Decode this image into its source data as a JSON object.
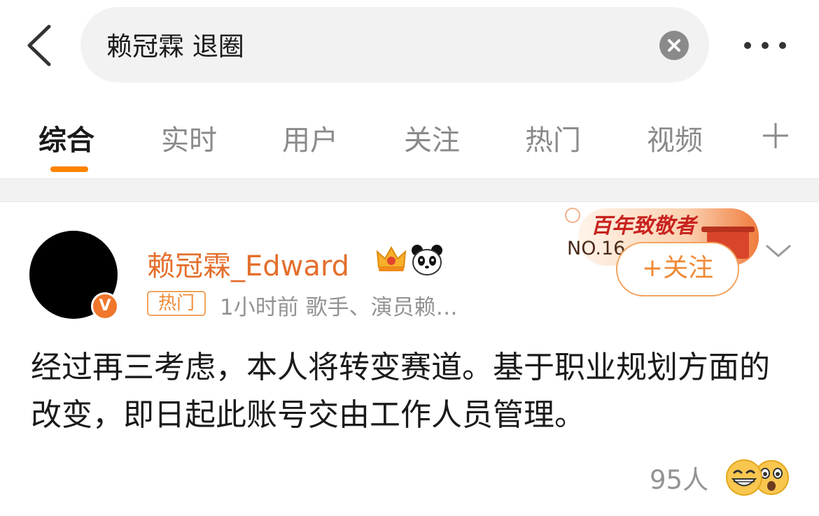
{
  "search": {
    "query": "赖冠霖 退圈"
  },
  "header_icons": {
    "back": "chevron-left-icon",
    "clear": "clear-x-icon",
    "more": "more-dots-icon"
  },
  "tabs": [
    {
      "label": "综合",
      "active": true
    },
    {
      "label": "实时",
      "active": false
    },
    {
      "label": "用户",
      "active": false
    },
    {
      "label": "关注",
      "active": false
    },
    {
      "label": "热门",
      "active": false
    },
    {
      "label": "视频",
      "active": false
    }
  ],
  "post": {
    "username": "赖冠霖_Edward",
    "verified_badge": "V",
    "hot_tag": "热门",
    "meta": "1小时前  歌手、演员赖…",
    "banner_title": "百年致敬者",
    "banner_rank": "NO.16",
    "follow_label": "+关注",
    "content": "经过再三考虑，本人将转变赛道。基于职业规划方面的改变，即日起此账号交由工作人员管理。",
    "reaction_count": "95人"
  },
  "colors": {
    "accent": "#ff8200",
    "username": "#e36f2c",
    "verified": "#f0762b",
    "muted": "#939393"
  }
}
